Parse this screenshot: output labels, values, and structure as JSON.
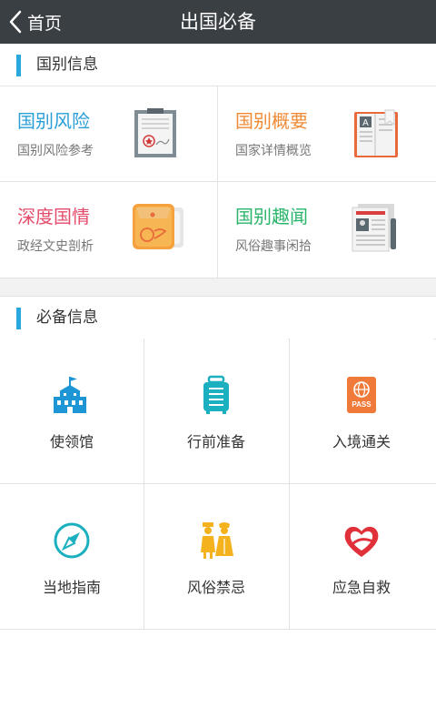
{
  "header": {
    "back_label": "首页",
    "title": "出国必备"
  },
  "section_country": {
    "title": "国别信息"
  },
  "country_cards": [
    {
      "title": "国别风险",
      "subtitle": "国别风险参考",
      "color": "#2a9fd8",
      "icon": "certificate-icon"
    },
    {
      "title": "国别概要",
      "subtitle": "国家详情概览",
      "color": "#f08a35",
      "icon": "book-icon"
    },
    {
      "title": "深度国情",
      "subtitle": "政经文史剖析",
      "color": "#e54b6a",
      "icon": "folder-icon"
    },
    {
      "title": "国别趣闻",
      "subtitle": "风俗趣事闲拾",
      "color": "#2ab56b",
      "icon": "newspaper-icon"
    }
  ],
  "section_essential": {
    "title": "必备信息"
  },
  "essentials": [
    {
      "label": "使领馆",
      "icon": "embassy-icon"
    },
    {
      "label": "行前准备",
      "icon": "luggage-icon"
    },
    {
      "label": "入境通关",
      "icon": "passport-icon"
    },
    {
      "label": "当地指南",
      "icon": "compass-icon"
    },
    {
      "label": "风俗禁忌",
      "icon": "people-icon"
    },
    {
      "label": "应急自救",
      "icon": "heart-icon"
    }
  ],
  "colors": {
    "topbar": "#3a3f43",
    "accent": "#29a8e0",
    "icon_blue": "#1e96d6",
    "icon_orange": "#f07a3a",
    "icon_teal": "#1bb0c0",
    "icon_yellow": "#f3b21e",
    "icon_red": "#e0303a"
  }
}
